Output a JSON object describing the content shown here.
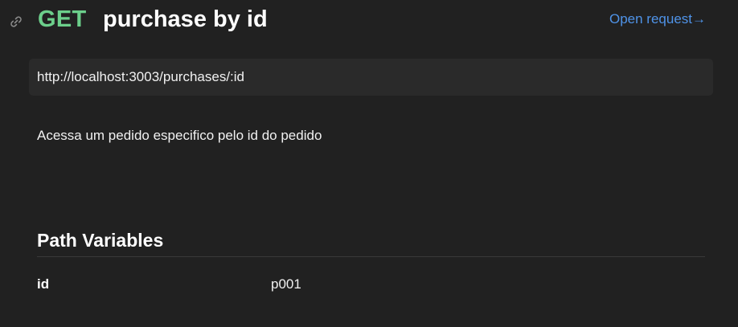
{
  "header": {
    "link_icon": "link-icon",
    "method": "GET",
    "method_color": "#6ccf8b",
    "title": "purchase by id",
    "open_request_label": "Open request→",
    "open_request_color": "#4f93e8"
  },
  "request": {
    "url": "http://localhost:3003/purchases/:id",
    "description": "Acessa um pedido especifico pelo id do pedido"
  },
  "path_variables": {
    "section_title": "Path Variables",
    "items": [
      {
        "key": "id",
        "value": "p001"
      }
    ]
  }
}
